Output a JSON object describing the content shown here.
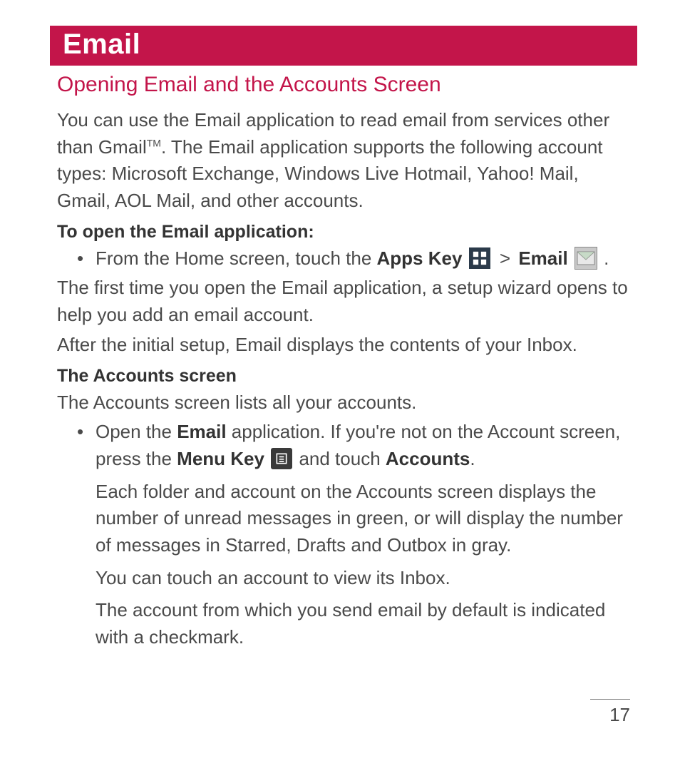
{
  "title": "Email",
  "section_heading": "Opening Email and the Accounts Screen",
  "intro_part1": "You can use the Email application to read email from services other than Gmail",
  "intro_tm": "TM",
  "intro_part2": ". The Email application supports the following account types: Microsoft Exchange, Windows Live Hotmail, Yahoo! Mail, Gmail, AOL Mail, and other accounts.",
  "open_heading": "To open the Email application:",
  "open_bullet_pre": "From the Home screen, touch the ",
  "apps_key_label": "Apps Key",
  "gt": ">",
  "email_label": "Email",
  "period": ".",
  "after_open_1": "The first time you open the Email application, a setup wizard opens to help you add an email account.",
  "after_open_2": "After the initial setup, Email displays the contents of your Inbox.",
  "accounts_heading": "The Accounts screen",
  "accounts_intro": "The Accounts screen lists all your accounts.",
  "accounts_bullet_pre": "Open the ",
  "accounts_bullet_email": "Email",
  "accounts_bullet_mid": " application. If you're not on the Account screen, press the ",
  "menu_key_label": "Menu Key",
  "accounts_bullet_post1": " and touch ",
  "accounts_label": "Accounts",
  "sub1": "Each folder and account on the Accounts screen displays the number of unread messages in green, or will display the number of messages in Starred, Drafts and Outbox in gray.",
  "sub2": "You can touch an account to view its Inbox.",
  "sub3": "The account from which you send email by default is indicated with a checkmark.",
  "page_number": "17"
}
